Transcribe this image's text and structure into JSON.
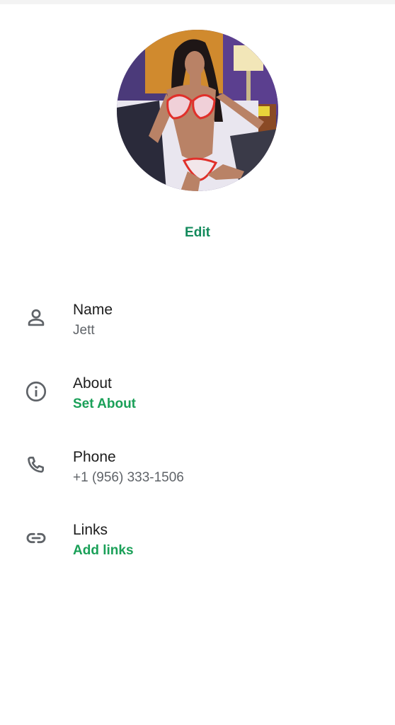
{
  "profile": {
    "avatar_icon": "profile-photo",
    "edit_label": "Edit"
  },
  "fields": {
    "name": {
      "icon": "person-icon",
      "title": "Name",
      "value": "Jett"
    },
    "about": {
      "icon": "info-icon",
      "title": "About",
      "value": "Set About"
    },
    "phone": {
      "icon": "phone-icon",
      "title": "Phone",
      "value": "+1 (956) 333-1506"
    },
    "links": {
      "icon": "link-icon",
      "title": "Links",
      "value": "Add links"
    }
  },
  "colors": {
    "accent": "#138a5c",
    "accent_light": "#1aa058",
    "icon_gray": "#5f6368",
    "text_dark": "#1c1c1c"
  }
}
